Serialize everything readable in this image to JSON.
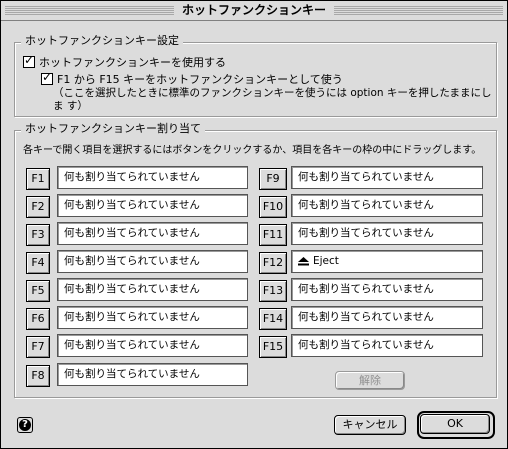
{
  "window": {
    "title": "ホットファンクションキー"
  },
  "settings": {
    "group_label": "ホットファンクションキー設定",
    "use_hotkeys": {
      "label": "ホットファンクションキーを使用する",
      "checked": true
    },
    "f1_f15": {
      "label": "F1 から F15 キーをホットファンクションキーとして使う",
      "checked": true
    },
    "note": "（ここを選択したときに標準のファンクションキーを使うには option キーを押したままにしま す）"
  },
  "assign": {
    "group_label": "ホットファンクションキー割り当て",
    "instructions": "各キーで開く項目を選択するにはボタンをクリックするか、項目を各キーの枠の中にドラッグします。",
    "left_keys": [
      {
        "key": "F1",
        "value": "何も割り当てられていません"
      },
      {
        "key": "F2",
        "value": "何も割り当てられていません"
      },
      {
        "key": "F3",
        "value": "何も割り当てられていません"
      },
      {
        "key": "F4",
        "value": "何も割り当てられていません"
      },
      {
        "key": "F5",
        "value": "何も割り当てられていません"
      },
      {
        "key": "F6",
        "value": "何も割り当てられていません"
      },
      {
        "key": "F7",
        "value": "何も割り当てられていません"
      },
      {
        "key": "F8",
        "value": "何も割り当てられていません"
      }
    ],
    "right_keys": [
      {
        "key": "F9",
        "value": "何も割り当てられていません"
      },
      {
        "key": "F10",
        "value": "何も割り当てられていません"
      },
      {
        "key": "F11",
        "value": "何も割り当てられていません"
      },
      {
        "key": "F12",
        "value": "Eject",
        "icon": "eject-icon"
      },
      {
        "key": "F13",
        "value": "何も割り当てられていません"
      },
      {
        "key": "F14",
        "value": "何も割り当てられていません"
      },
      {
        "key": "F15",
        "value": "何も割り当てられていません"
      }
    ],
    "clear_label": "解除"
  },
  "footer": {
    "help_icon": "help-icon",
    "cancel_label": "キャンセル",
    "ok_label": "OK"
  }
}
